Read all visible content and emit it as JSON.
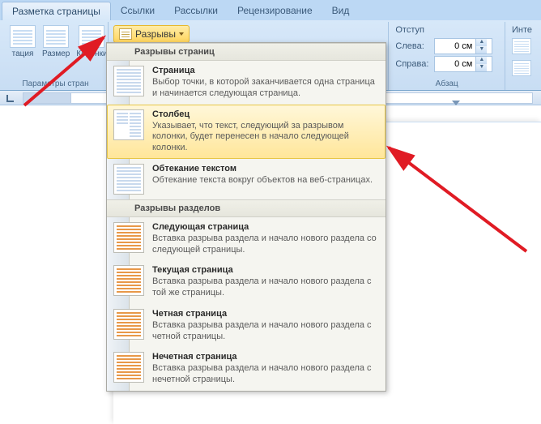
{
  "tabs": {
    "page_layout": "Разметка страницы",
    "references": "Ссылки",
    "mailings": "Рассылки",
    "review": "Рецензирование",
    "view": "Вид"
  },
  "toolbar": {
    "orientation": "тация",
    "size": "Размер",
    "columns": "Колонки",
    "page_setup_group": "Параметры стран",
    "breaks_label": "Разрывы",
    "indent": {
      "header": "Отступ",
      "left_label": "Слева:",
      "right_label": "Справа:",
      "left_value": "0 см",
      "right_value": "0 см",
      "interval": "Инте",
      "paragraph_group": "Абзац"
    }
  },
  "menu": {
    "section_pages": "Разрывы страниц",
    "section_sections": "Разрывы разделов",
    "items": {
      "page": {
        "title": "Страница",
        "desc": "Выбор точки, в которой заканчивается одна страница и начинается следующая страница."
      },
      "column": {
        "title": "Столбец",
        "desc": "Указывает, что текст, следующий за разрывом колонки, будет перенесен в начало следующей колонки."
      },
      "textwrap": {
        "title": "Обтекание текстом",
        "desc": "Обтекание текста вокруг объектов на веб-страницах."
      },
      "nextpage": {
        "title": "Следующая страница",
        "desc": "Вставка разрыва раздела и начало нового раздела со следующей страницы."
      },
      "continuous": {
        "title": "Текущая страница",
        "desc": "Вставка разрыва раздела и начало нового раздела с той же страницы."
      },
      "evenpage": {
        "title": "Четная страница",
        "desc": "Вставка разрыва раздела и начало нового раздела с четной страницы."
      },
      "oddpage": {
        "title": "Нечетная страница",
        "desc": "Вставка разрыва раздела и начало нового раздела с нечетной страницы."
      }
    }
  }
}
